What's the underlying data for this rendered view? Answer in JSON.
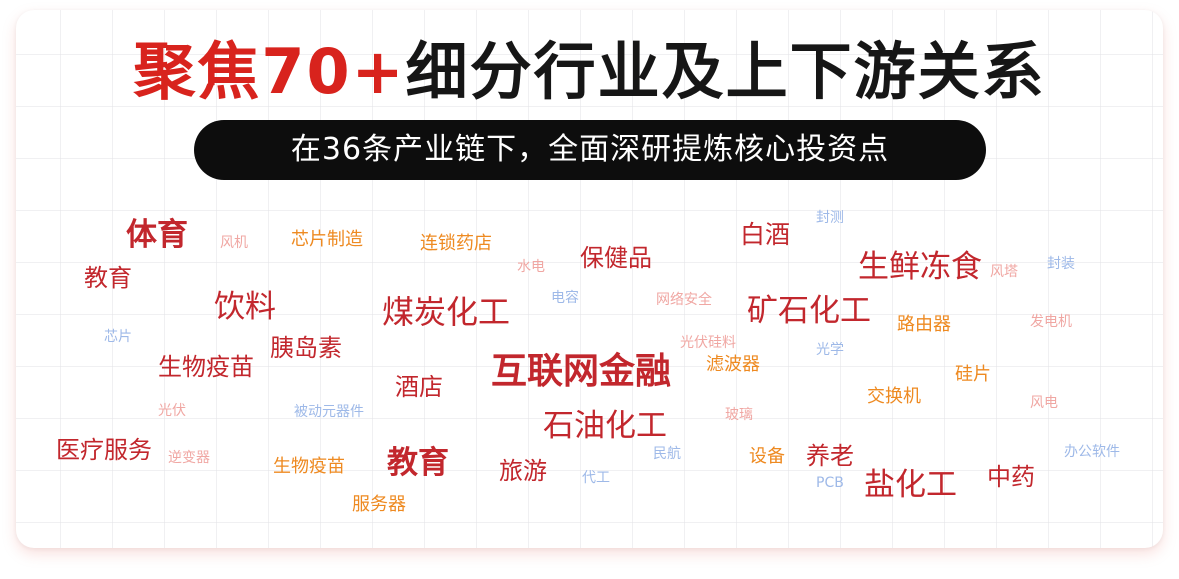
{
  "headline": {
    "red_part": "聚焦70+",
    "black_part": "细分行业及上下游关系"
  },
  "subtitle": "在36条产业链下，全面深研提炼核心投资点",
  "colors": {
    "red": "#d8231d",
    "dark_red": "#c2272d",
    "orange": "#ee8a21",
    "pink": "#f0a7a3",
    "blue": "#9eb9e8",
    "black": "#161616"
  },
  "keywords": [
    {
      "text": "体育"
    },
    {
      "text": "风机"
    },
    {
      "text": "芯片制造"
    },
    {
      "text": "连锁药店"
    },
    {
      "text": "水电"
    },
    {
      "text": "保健品"
    },
    {
      "text": "白酒"
    },
    {
      "text": "封测"
    },
    {
      "text": "生鲜冻食"
    },
    {
      "text": "风塔"
    },
    {
      "text": "封装"
    },
    {
      "text": "教育"
    },
    {
      "text": "饮料"
    },
    {
      "text": "煤炭化工"
    },
    {
      "text": "电容"
    },
    {
      "text": "网络安全"
    },
    {
      "text": "矿石化工"
    },
    {
      "text": "路由器"
    },
    {
      "text": "发电机"
    },
    {
      "text": "芯片"
    },
    {
      "text": "胰岛素"
    },
    {
      "text": "光伏硅料"
    },
    {
      "text": "光学"
    },
    {
      "text": "生物疫苗"
    },
    {
      "text": "互联网金融"
    },
    {
      "text": "滤波器"
    },
    {
      "text": "硅片"
    },
    {
      "text": "酒店"
    },
    {
      "text": "交换机"
    },
    {
      "text": "光伏"
    },
    {
      "text": "被动元器件"
    },
    {
      "text": "玻璃"
    },
    {
      "text": "风电"
    },
    {
      "text": "石油化工"
    },
    {
      "text": "医疗服务"
    },
    {
      "text": "民航"
    },
    {
      "text": "设备"
    },
    {
      "text": "养老"
    },
    {
      "text": "办公软件"
    },
    {
      "text": "逆变器"
    },
    {
      "text": "生物疫苗"
    },
    {
      "text": "教育"
    },
    {
      "text": "旅游"
    },
    {
      "text": "代工"
    },
    {
      "text": "中药"
    },
    {
      "text": "PCB"
    },
    {
      "text": "盐化工"
    },
    {
      "text": "服务器"
    }
  ]
}
